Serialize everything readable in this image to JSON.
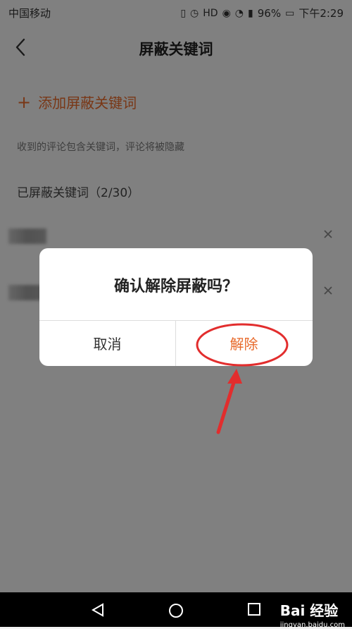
{
  "status": {
    "carrier": "中国移动",
    "battery": "96%",
    "time": "下午2:29"
  },
  "header": {
    "title": "屏蔽关键词"
  },
  "content": {
    "add_label": "添加屏蔽关键词",
    "hint": "收到的评论包含关键词，评论将被隐藏",
    "section_title": "已屏蔽关键词（2/30）"
  },
  "dialog": {
    "message": "确认解除屏蔽吗？",
    "cancel": "取消",
    "confirm": "解除"
  },
  "watermark": {
    "brand": "Bai 经验",
    "url": "jingyan.baidu.com"
  }
}
